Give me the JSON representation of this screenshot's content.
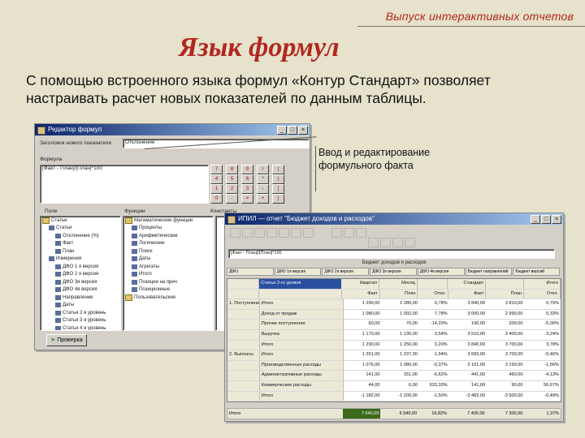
{
  "header": {
    "tag": "Выпуск интерактивных отчетов",
    "title": "Язык формул"
  },
  "lead": "С помощью встроенного языка формул «Контур Стандарт» позволяет настраивать расчет новых показателей по данным таблицы.",
  "callout": "Ввод и редактирование формульного факта",
  "editor": {
    "window_title": "Редактор формул",
    "name_label": "Заголовок нового показателя",
    "name_value": "Отклонение",
    "formula_label": "Формула",
    "formula_value": "[Факт - План]/[План]*100",
    "key_buttons": [
      "7",
      "8",
      "9",
      "/",
      "(",
      "4",
      "5",
      "6",
      "*",
      ")",
      "1",
      "2",
      "3",
      "-",
      "[",
      "0",
      ".",
      "=",
      "+",
      "]"
    ],
    "list1_label": "Поле",
    "list2_label": "Функции",
    "list3_label": "Константы",
    "fields": [
      {
        "name": "Статьи",
        "level": 0
      },
      {
        "name": "Статьи",
        "level": 1
      },
      {
        "name": "Отклонение (%)",
        "level": 2
      },
      {
        "name": "Факт",
        "level": 2
      },
      {
        "name": "План",
        "level": 2
      },
      {
        "name": "Измерения",
        "level": 1
      },
      {
        "name": "ДФО 1 я версия",
        "level": 2
      },
      {
        "name": "ДФО 2 я версия",
        "level": 2
      },
      {
        "name": "ДФО 3я версия",
        "level": 2
      },
      {
        "name": "ДФО 4я версия",
        "level": 2
      },
      {
        "name": "Направление",
        "level": 2
      },
      {
        "name": "Даты",
        "level": 2
      },
      {
        "name": "Статья 2 я уровень",
        "level": 2
      },
      {
        "name": "Статья 3 я уровень",
        "level": 2
      },
      {
        "name": "Статья 4 я уровень",
        "level": 2
      }
    ],
    "functions": [
      {
        "name": "Математические функции",
        "level": 0
      },
      {
        "name": "Проценты",
        "level": 1
      },
      {
        "name": "Арифметические",
        "level": 1
      },
      {
        "name": "Логические",
        "level": 1
      },
      {
        "name": "Поиск",
        "level": 1
      },
      {
        "name": "Даты",
        "level": 1
      },
      {
        "name": "Агрегаты",
        "level": 1
      },
      {
        "name": "Итого",
        "level": 1
      },
      {
        "name": "Позиции на прич",
        "level": 1
      },
      {
        "name": "Позиционные",
        "level": 1
      },
      {
        "name": "Пользовательские",
        "level": 0
      }
    ],
    "check_button": "Проверка"
  },
  "report": {
    "window_title": "ИПИЛ — отчет \"Бюджет доходов и расходов\"",
    "formula_value": "[Факт - План]/[План]*100",
    "report_title": "Бюджет доходов и расходов",
    "dim_filters": [
      "ДФО",
      "ДФО 1я версия",
      "ДФО 2я версия",
      "ДФО 3я версия",
      "ДФО 4я версия",
      "Бюджет направлений",
      "Бюджет версий"
    ],
    "row_header": "Статья 2-го уровня",
    "col_groups": [
      "Квартал",
      "Месяц",
      "Стандарт",
      "Итого"
    ],
    "col_heads": [
      "Факт",
      "План",
      "Откл.",
      "Факт",
      "План",
      "Откл."
    ],
    "rows": [
      {
        "label": "1. Поступления",
        "sub": "Итого",
        "v": [
          "1 290,00",
          "1 280,00",
          "0,78%",
          "3 840,00",
          "3 810,00",
          "0,79%"
        ]
      },
      {
        "label": "",
        "sub": "Доход от продаж",
        "v": [
          "1 080,00",
          "1 002,00",
          "7,78%",
          "3 000,00",
          "2 990,00",
          "0,33%"
        ]
      },
      {
        "label": "",
        "sub": "Прочие поступления",
        "v": [
          "60,00",
          "70,00",
          "-14,29%",
          "190,00",
          "200,00",
          "-5,00%"
        ]
      },
      {
        "label": "",
        "sub": "Выручка",
        "v": [
          "1 170,00",
          "1 130,00",
          "3,54%",
          "3 510,00",
          "3 400,00",
          "3,24%"
        ]
      },
      {
        "label": "",
        "sub": "Итого",
        "v": [
          "1 290,00",
          "1 250,00",
          "3,20%",
          "3 840,00",
          "3 700,00",
          "3,78%"
        ]
      },
      {
        "label": "2. Выплаты",
        "sub": "Итого",
        "v": [
          "1 261,00",
          "1 237,00",
          "1,94%",
          "3 683,00",
          "3 700,00",
          "-0,46%"
        ]
      },
      {
        "label": "",
        "sub": "Производственные расходы",
        "v": [
          "1 076,00",
          "1 080,00",
          "-0,37%",
          "3 101,00",
          "3 150,00",
          "-1,56%"
        ]
      },
      {
        "label": "",
        "sub": "Административные расходы",
        "v": [
          "141,00",
          "151,00",
          "-6,62%",
          "441,00",
          "460,00",
          "-4,13%"
        ]
      },
      {
        "label": "",
        "sub": "Коммерческие расходы",
        "v": [
          "44,00",
          "6,00",
          "633,33%",
          "141,00",
          "90,00",
          "56,67%"
        ]
      },
      {
        "label": "",
        "sub": "Итого",
        "v": [
          "-1 182,00",
          "-1 200,00",
          "-1,50%",
          "-3 483,00",
          "-3 500,00",
          "-0,49%"
        ]
      }
    ],
    "total_label": "Итого",
    "total_values": [
      "7 640,00",
      "6 540,00",
      "16,82%",
      "7 400,00",
      "7 300,00",
      "1,37%"
    ]
  },
  "colors": {
    "accent": "#b3261e",
    "slide_bg": "#e6e2cc",
    "titlebar": "#0a246a",
    "window": "#d4d0c8"
  }
}
